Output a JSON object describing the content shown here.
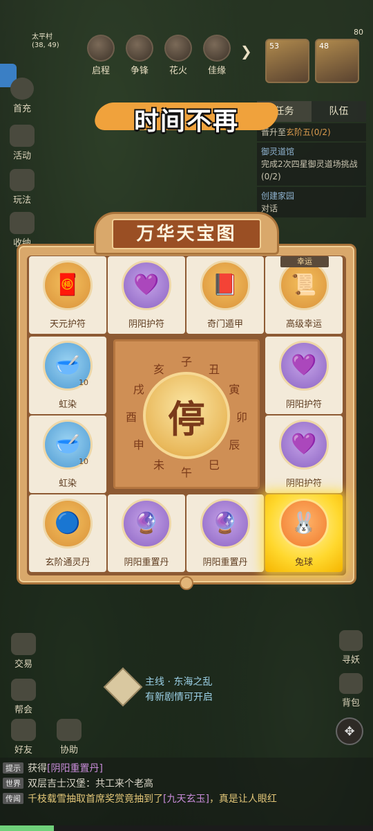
{
  "top": {
    "village": "太平村",
    "coords": "(38, 49)",
    "battery": "80",
    "icons": [
      {
        "label": "启程",
        "icon": "journey-icon"
      },
      {
        "label": "争锋",
        "icon": "battle-icon"
      },
      {
        "label": "花火",
        "icon": "fireworks-icon"
      },
      {
        "label": "佳缘",
        "icon": "romance-icon"
      }
    ],
    "portraits": [
      {
        "level": "53"
      },
      {
        "level": "48"
      }
    ]
  },
  "left_menu": [
    {
      "label": "首充",
      "icon": "first-charge-icon"
    },
    {
      "label": "活动",
      "icon": "event-icon"
    },
    {
      "label": "玩法",
      "icon": "gameplay-icon"
    },
    {
      "label": "收纳",
      "icon": "storage-icon"
    }
  ],
  "quest_panel": {
    "tabs": [
      "任务",
      "队伍"
    ],
    "items": [
      {
        "text": "晋升至",
        "highlight": "玄阶五(0/2)"
      },
      {
        "title": "御灵道馆",
        "text": "完成2次四星御灵道场挑战(0/2)"
      },
      {
        "title": "创建家园",
        "text": "对话"
      }
    ]
  },
  "banner": {
    "text": "时间不再"
  },
  "board": {
    "title": "万华天宝图",
    "center_button": "停",
    "ring_chars": [
      "子",
      "丑",
      "寅",
      "卯",
      "辰",
      "巳",
      "午",
      "未",
      "申",
      "酉",
      "戌",
      "亥"
    ],
    "cells": [
      {
        "label": "天元护符",
        "icon": "amulet-red-icon",
        "glyph": "🧧",
        "style": "gold"
      },
      {
        "label": "阴阳护符",
        "icon": "amulet-purple-icon",
        "glyph": "💜",
        "style": "purple"
      },
      {
        "label": "奇门遁甲",
        "icon": "book-icon",
        "glyph": "📕",
        "style": "gold"
      },
      {
        "label": "高级幸运",
        "icon": "scroll-icon",
        "glyph": "📜",
        "style": "gold",
        "tag": "幸运"
      },
      {
        "label": "虹染",
        "icon": "dye-bowl-icon",
        "glyph": "🥣",
        "style": "blue",
        "count": "10"
      },
      {
        "label": "阴阳护符",
        "icon": "amulet-purple-icon",
        "glyph": "💜",
        "style": "purple"
      },
      {
        "label": "虹染",
        "icon": "dye-bowl-icon",
        "glyph": "🥣",
        "style": "blue",
        "count": "10"
      },
      {
        "label": "阴阳护符",
        "icon": "amulet-purple-icon",
        "glyph": "💜",
        "style": "purple"
      },
      {
        "label": "玄阶通灵丹",
        "icon": "spirit-pill-icon",
        "glyph": "🔵",
        "style": "gold"
      },
      {
        "label": "阴阳重置丹",
        "icon": "reset-orb-icon",
        "glyph": "🔮",
        "style": "purple"
      },
      {
        "label": "阴阳重置丹",
        "icon": "reset-orb-icon",
        "glyph": "🔮",
        "style": "purple"
      },
      {
        "label": "兔球",
        "icon": "bunny-ball-icon",
        "glyph": "🐰",
        "style": "highlight"
      }
    ]
  },
  "side_bottom_left": [
    {
      "label": "交易",
      "icon": "trade-icon"
    },
    {
      "label": "帮会",
      "icon": "guild-icon"
    },
    {
      "label": "好友",
      "icon": "friends-icon"
    },
    {
      "label": "协助",
      "icon": "assist-icon"
    }
  ],
  "side_bottom_right": [
    {
      "label": "寻妖",
      "icon": "seek-icon"
    },
    {
      "label": "背包",
      "icon": "bag-icon"
    }
  ],
  "mainline": {
    "title": "主线 · 东海之乱",
    "subtitle": "有新剧情可开启"
  },
  "chat": [
    {
      "channel": "提示",
      "text": "获得",
      "item": "[阴阳重置丹]"
    },
    {
      "channel": "世界",
      "text": "双层吉士汉堡：共工来个老高"
    },
    {
      "channel": "传闻",
      "text": "千枝载雪抽取首席奖赏竟抽到了",
      "item": "[九天玄玉]",
      "tail": "，真是让人眼红"
    }
  ]
}
